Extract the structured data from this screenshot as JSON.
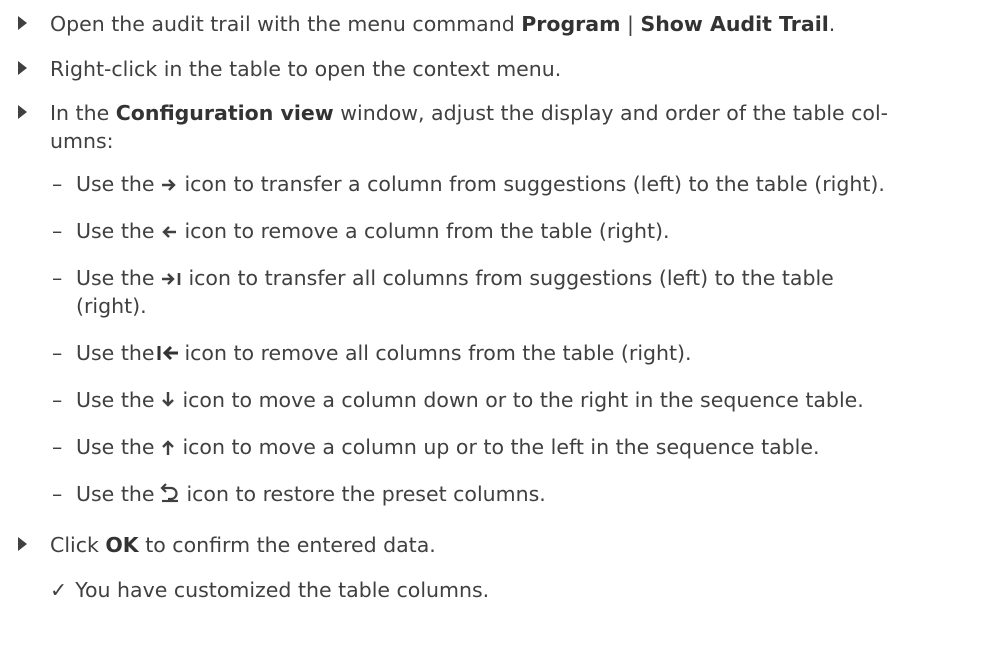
{
  "steps": [
    {
      "pre": "Open the audit trail with the menu command ",
      "bold1": "Program",
      "sep": " | ",
      "bold2": "Show Audit Trail",
      "post": "."
    },
    {
      "text": "Right-click in the table to open the context menu."
    },
    {
      "pre": "In the ",
      "bold": "Configuration view",
      "post_line1": " window, adjust the display and order of the table col-",
      "line2": "umns:"
    },
    {
      "pre": "Click ",
      "bold": "OK",
      "post": " to confirm the entered data."
    }
  ],
  "substeps": [
    {
      "icon": "arrow-right-icon",
      "pre": "Use the",
      "post": "icon to transfer a column from suggestions (left) to the table (right)."
    },
    {
      "icon": "arrow-left-icon",
      "pre": "Use the",
      "post": "icon to remove a column from the table (right)."
    },
    {
      "icon": "arrow-right-bar-icon",
      "pre": "Use the",
      "post_line1": "icon to transfer all columns from suggestions (left) to the table",
      "line2": "(right)."
    },
    {
      "icon": "bar-arrow-left-icon",
      "pre": "Use the",
      "post": "icon to remove all columns from the table (right)."
    },
    {
      "icon": "arrow-down-icon",
      "pre": "Use the",
      "post": "icon to move a column down or to the right in the sequence table."
    },
    {
      "icon": "arrow-up-icon",
      "pre": "Use the",
      "post": "icon to move a column up or to the left in the sequence table."
    },
    {
      "icon": "restore-icon",
      "pre": "Use the",
      "post": "icon to restore the preset columns."
    }
  ],
  "dash": "–",
  "result": {
    "check": "✓",
    "text": "You have customized the table columns."
  }
}
